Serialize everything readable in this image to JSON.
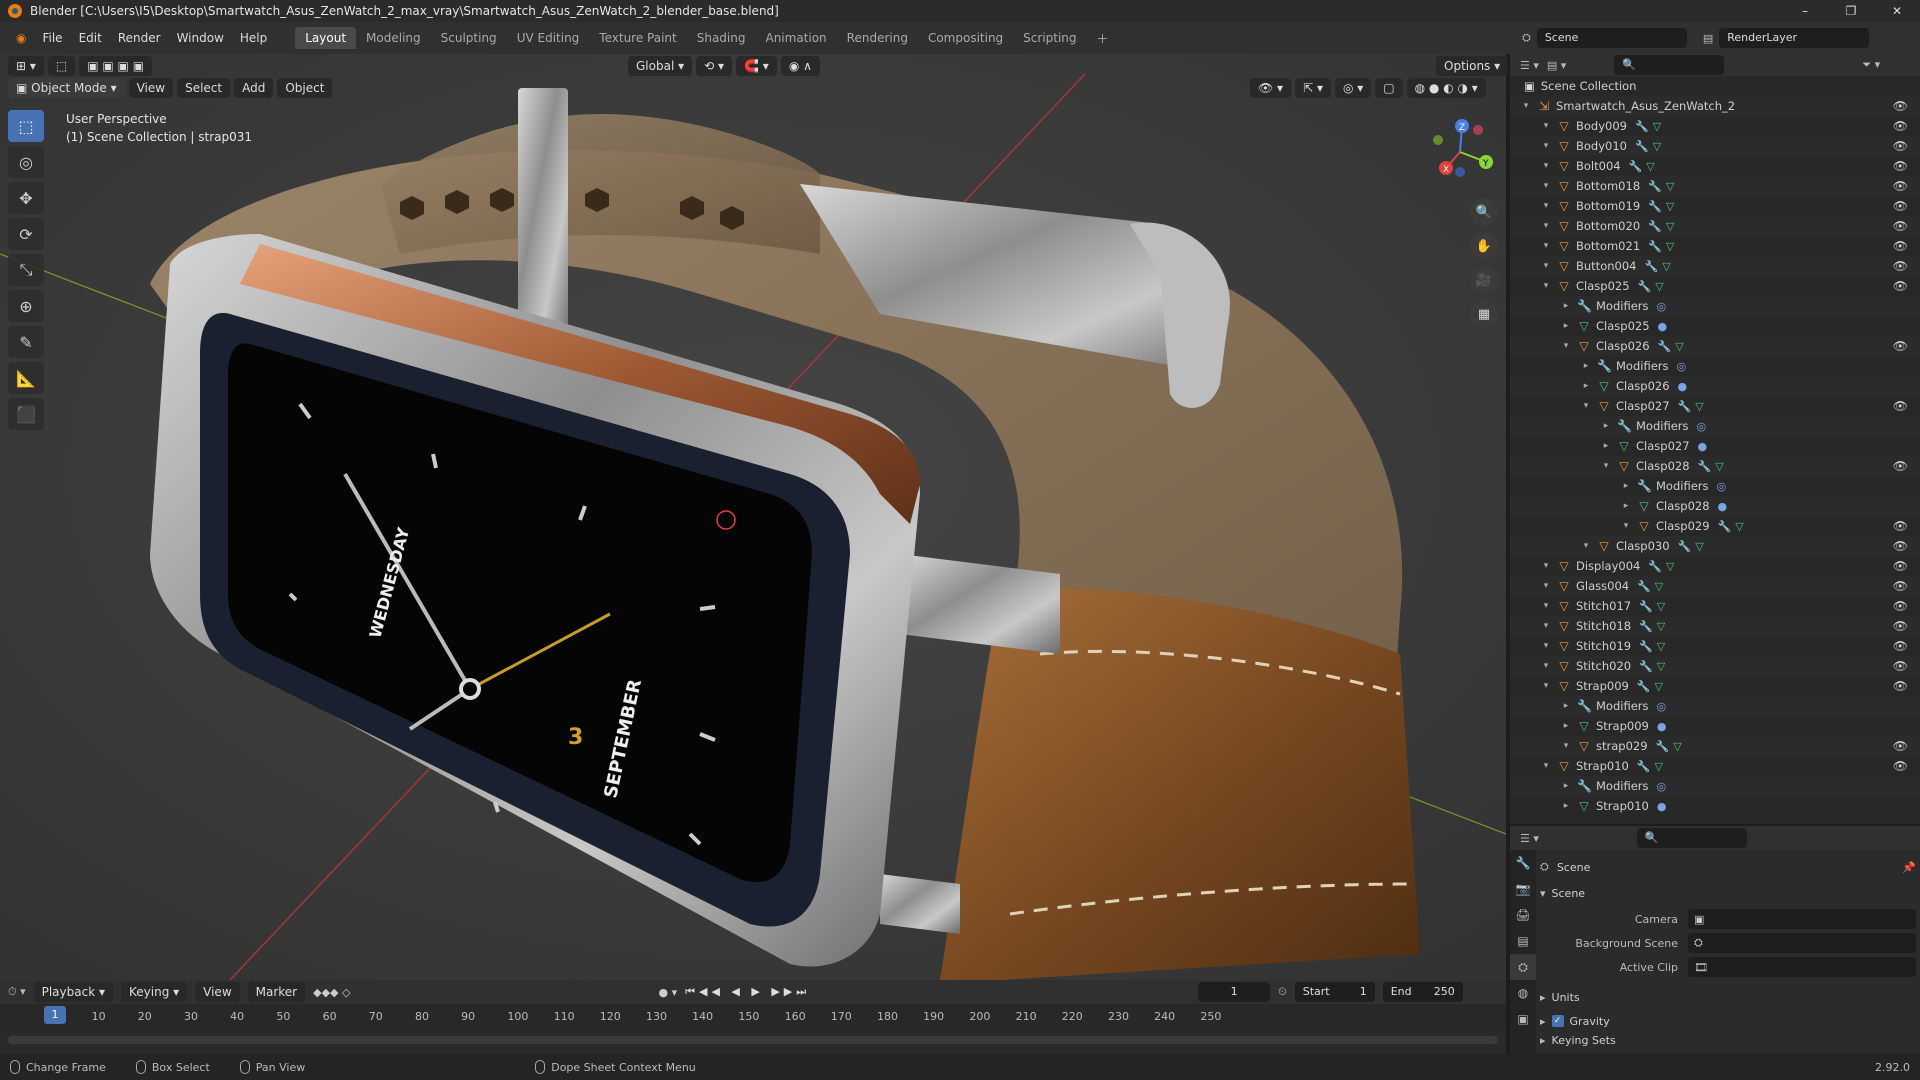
{
  "window": {
    "title": "Blender [C:\\Users\\I5\\Desktop\\Smartwatch_Asus_ZenWatch_2_max_vray\\Smartwatch_Asus_ZenWatch_2_blender_base.blend]"
  },
  "menus": [
    "File",
    "Edit",
    "Render",
    "Window",
    "Help"
  ],
  "workspaces": [
    "Layout",
    "Modeling",
    "Sculpting",
    "UV Editing",
    "Texture Paint",
    "Shading",
    "Animation",
    "Rendering",
    "Compositing",
    "Scripting"
  ],
  "top": {
    "scene": "Scene",
    "render_layer": "RenderLayer"
  },
  "viewport": {
    "mode": "Object Mode",
    "menus": [
      "View",
      "Select",
      "Add",
      "Object"
    ],
    "orientation": "Global",
    "options": "Options",
    "overlay_line1": "User Perspective",
    "overlay_line2": "(1) Scene Collection | strap031",
    "watch_day": "WEDNESDAY",
    "watch_date": "3",
    "watch_month": "SEPTEMBER",
    "axis_x": "X",
    "axis_y": "Y",
    "axis_z": "Z"
  },
  "outliner": {
    "root": "Scene Collection",
    "rows": [
      {
        "name": "Smartwatch_Asus_ZenWatch_2",
        "depth": 0,
        "type": "collection"
      },
      {
        "name": "Body009",
        "depth": 1,
        "type": "object"
      },
      {
        "name": "Body010",
        "depth": 1,
        "type": "object"
      },
      {
        "name": "Bolt004",
        "depth": 1,
        "type": "object"
      },
      {
        "name": "Bottom018",
        "depth": 1,
        "type": "object"
      },
      {
        "name": "Bottom019",
        "depth": 1,
        "type": "object"
      },
      {
        "name": "Bottom020",
        "depth": 1,
        "type": "object"
      },
      {
        "name": "Bottom021",
        "depth": 1,
        "type": "object"
      },
      {
        "name": "Button004",
        "depth": 1,
        "type": "object"
      },
      {
        "name": "Clasp025",
        "depth": 1,
        "type": "object"
      },
      {
        "name": "Modifiers",
        "depth": 2,
        "type": "modifiers"
      },
      {
        "name": "Clasp025",
        "depth": 2,
        "type": "mesh"
      },
      {
        "name": "Clasp026",
        "depth": 2,
        "type": "object"
      },
      {
        "name": "Modifiers",
        "depth": 3,
        "type": "modifiers"
      },
      {
        "name": "Clasp026",
        "depth": 3,
        "type": "mesh"
      },
      {
        "name": "Clasp027",
        "depth": 3,
        "type": "object"
      },
      {
        "name": "Modifiers",
        "depth": 4,
        "type": "modifiers"
      },
      {
        "name": "Clasp027",
        "depth": 4,
        "type": "mesh"
      },
      {
        "name": "Clasp028",
        "depth": 4,
        "type": "object"
      },
      {
        "name": "Modifiers",
        "depth": 5,
        "type": "modifiers"
      },
      {
        "name": "Clasp028",
        "depth": 5,
        "type": "mesh"
      },
      {
        "name": "Clasp029",
        "depth": 5,
        "type": "object"
      },
      {
        "name": "Clasp030",
        "depth": 3,
        "type": "object"
      },
      {
        "name": "Display004",
        "depth": 1,
        "type": "object"
      },
      {
        "name": "Glass004",
        "depth": 1,
        "type": "object"
      },
      {
        "name": "Stitch017",
        "depth": 1,
        "type": "object"
      },
      {
        "name": "Stitch018",
        "depth": 1,
        "type": "object"
      },
      {
        "name": "Stitch019",
        "depth": 1,
        "type": "object"
      },
      {
        "name": "Stitch020",
        "depth": 1,
        "type": "object"
      },
      {
        "name": "Strap009",
        "depth": 1,
        "type": "object"
      },
      {
        "name": "Modifiers",
        "depth": 2,
        "type": "modifiers"
      },
      {
        "name": "Strap009",
        "depth": 2,
        "type": "mesh"
      },
      {
        "name": "strap029",
        "depth": 2,
        "type": "object"
      },
      {
        "name": "Strap010",
        "depth": 1,
        "type": "object"
      },
      {
        "name": "Modifiers",
        "depth": 2,
        "type": "modifiers"
      },
      {
        "name": "Strap010",
        "depth": 2,
        "type": "mesh"
      }
    ]
  },
  "properties": {
    "context": "Scene",
    "panel": "Scene",
    "camera_label": "Camera",
    "bg_scene_label": "Background Scene",
    "active_clip_label": "Active Clip",
    "units": "Units",
    "gravity": "Gravity",
    "keying_sets": "Keying Sets"
  },
  "timeline": {
    "menus": [
      "Playback",
      "Keying",
      "View",
      "Marker"
    ],
    "current_frame": "1",
    "start_label": "Start",
    "start": "1",
    "end_label": "End",
    "end": "250",
    "ticks": [
      "1",
      "10",
      "20",
      "30",
      "40",
      "50",
      "60",
      "70",
      "80",
      "90",
      "100",
      "110",
      "120",
      "130",
      "140",
      "150",
      "160",
      "170",
      "180",
      "190",
      "200",
      "210",
      "220",
      "230",
      "240",
      "250"
    ]
  },
  "status": {
    "change_frame": "Change Frame",
    "box_select": "Box Select",
    "pan_view": "Pan View",
    "context_menu": "Dope Sheet Context Menu",
    "version": "2.92.0"
  }
}
